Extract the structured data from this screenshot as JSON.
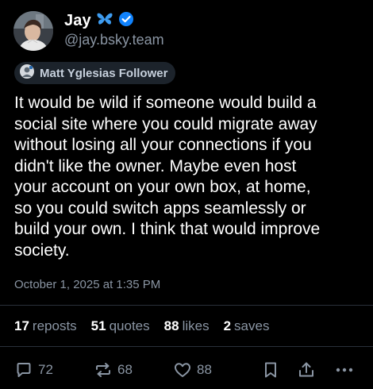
{
  "author": {
    "display_name": "Jay",
    "handle": "@jay.bsky.team",
    "avatar_icon": "avatar-photo",
    "name_emoji_icon": "butterfly-icon",
    "verified_icon": "verified-badge-icon"
  },
  "label": {
    "text": "Matt Yglesias Follower",
    "icon": "labeler-avatar-icon"
  },
  "post": {
    "text": "It would be wild if someone would build a\nsocial site where you could migrate away\nwithout losing all your connections if you\ndidn't like the owner. Maybe even host\nyour account on your own box, at home,\nso you could switch apps seamlessly or\nbuild your own. I think that would improve\nsociety.",
    "timestamp": "October 1, 2025 at 1:35 PM"
  },
  "stats": {
    "reposts_count": "17",
    "reposts_label": "reposts",
    "quotes_count": "51",
    "quotes_label": "quotes",
    "likes_count": "88",
    "likes_label": "likes",
    "saves_count": "2",
    "saves_label": "saves"
  },
  "actions": {
    "reply_count": "72",
    "repost_count": "68",
    "like_count": "88"
  },
  "colors": {
    "background": "#000000",
    "text": "#ffffff",
    "muted": "#8a95a3",
    "verified": "#1083fe",
    "butterfly": "#3e9cf0",
    "pill_bg": "#1c232b"
  }
}
